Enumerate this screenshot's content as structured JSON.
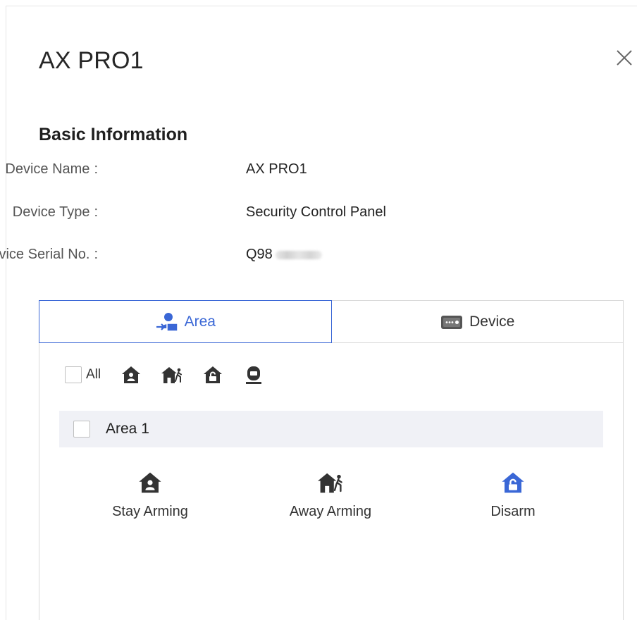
{
  "dialog": {
    "title": "AX PRO1",
    "close_icon": "close-icon"
  },
  "basic_info": {
    "heading": "Basic Information",
    "rows": [
      {
        "label": "Device Name",
        "value": "AX PRO1"
      },
      {
        "label": "Device Type",
        "value": "Security Control Panel"
      },
      {
        "label": "Device Serial No.",
        "value": "Q98"
      }
    ],
    "colon": ":"
  },
  "tabs": [
    {
      "label": "Area",
      "icon": "area-icon",
      "active": true
    },
    {
      "label": "Device",
      "icon": "device-icon",
      "active": false
    }
  ],
  "toolbar": {
    "all_label": "All",
    "icons": [
      "stay-arm-icon",
      "away-arm-icon",
      "disarm-icon",
      "clear-alarm-icon"
    ]
  },
  "area": {
    "name": "Area 1"
  },
  "actions": [
    {
      "label": "Stay Arming",
      "icon": "stay-arm-icon"
    },
    {
      "label": "Away Arming",
      "icon": "away-arm-icon"
    },
    {
      "label": "Disarm",
      "icon": "disarm-icon"
    }
  ],
  "colors": {
    "accent": "#3a67d6",
    "icon_dark": "#333333",
    "row_bg": "#f0f1f6",
    "border": "#d9d9d9"
  }
}
